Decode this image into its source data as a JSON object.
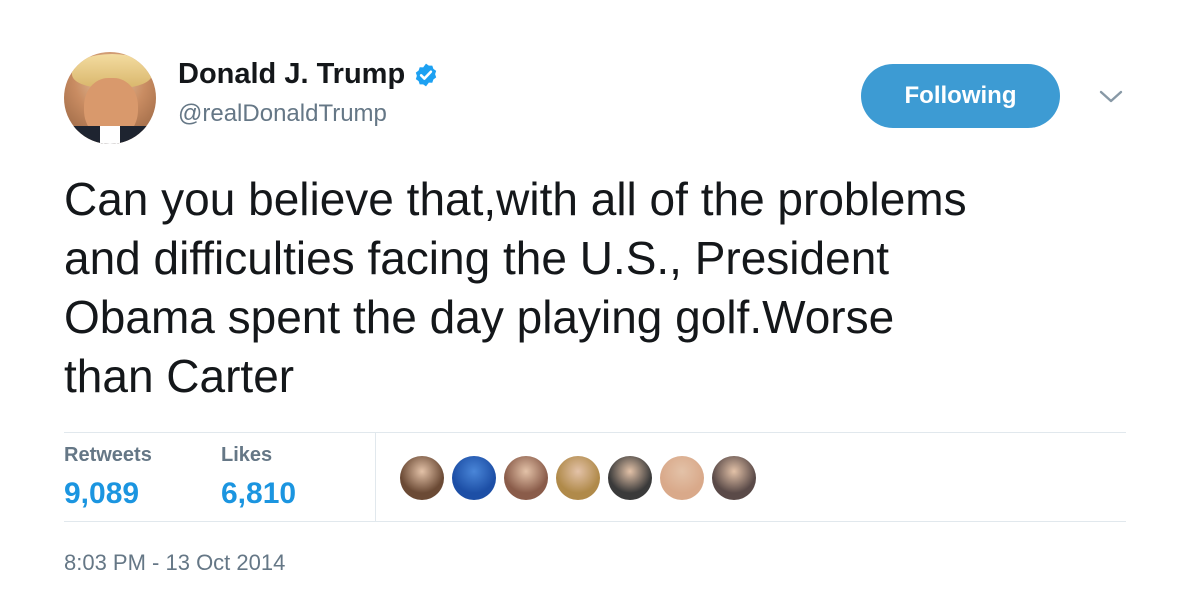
{
  "author": {
    "name": "Donald J. Trump",
    "handle": "@realDonaldTrump",
    "verified": true
  },
  "follow_button": {
    "label": "Following"
  },
  "tweet": {
    "lines": [
      "Can you believe that,with all of the problems",
      "and difficulties facing the U.S., President",
      "Obama spent the day playing golf.Worse",
      "than Carter"
    ]
  },
  "stats": {
    "retweets_label": "Retweets",
    "retweets_value": "9,089",
    "likes_label": "Likes",
    "likes_value": "6,810"
  },
  "likers": [
    {
      "icon": "avatar-photo-man",
      "color": "#6b4a35"
    },
    {
      "icon": "avatar-blue-logo",
      "color": "#1d4fa6"
    },
    {
      "icon": "avatar-photo-couple",
      "color": "#8a5c4a"
    },
    {
      "icon": "avatar-photo-lights",
      "color": "#b08a4a"
    },
    {
      "icon": "avatar-photo-man-dark",
      "color": "#3a3a3a"
    },
    {
      "icon": "avatar-photo-woman-glasses",
      "color": "#d9a98a"
    },
    {
      "icon": "avatar-photo-dark",
      "color": "#5a4a48"
    }
  ],
  "timestamp": "8:03 PM - 13 Oct 2014",
  "colors": {
    "link_blue": "#1b95e0",
    "button_blue": "#3d9bd3",
    "muted_gray": "#657786",
    "divider": "#e1e8ed"
  }
}
